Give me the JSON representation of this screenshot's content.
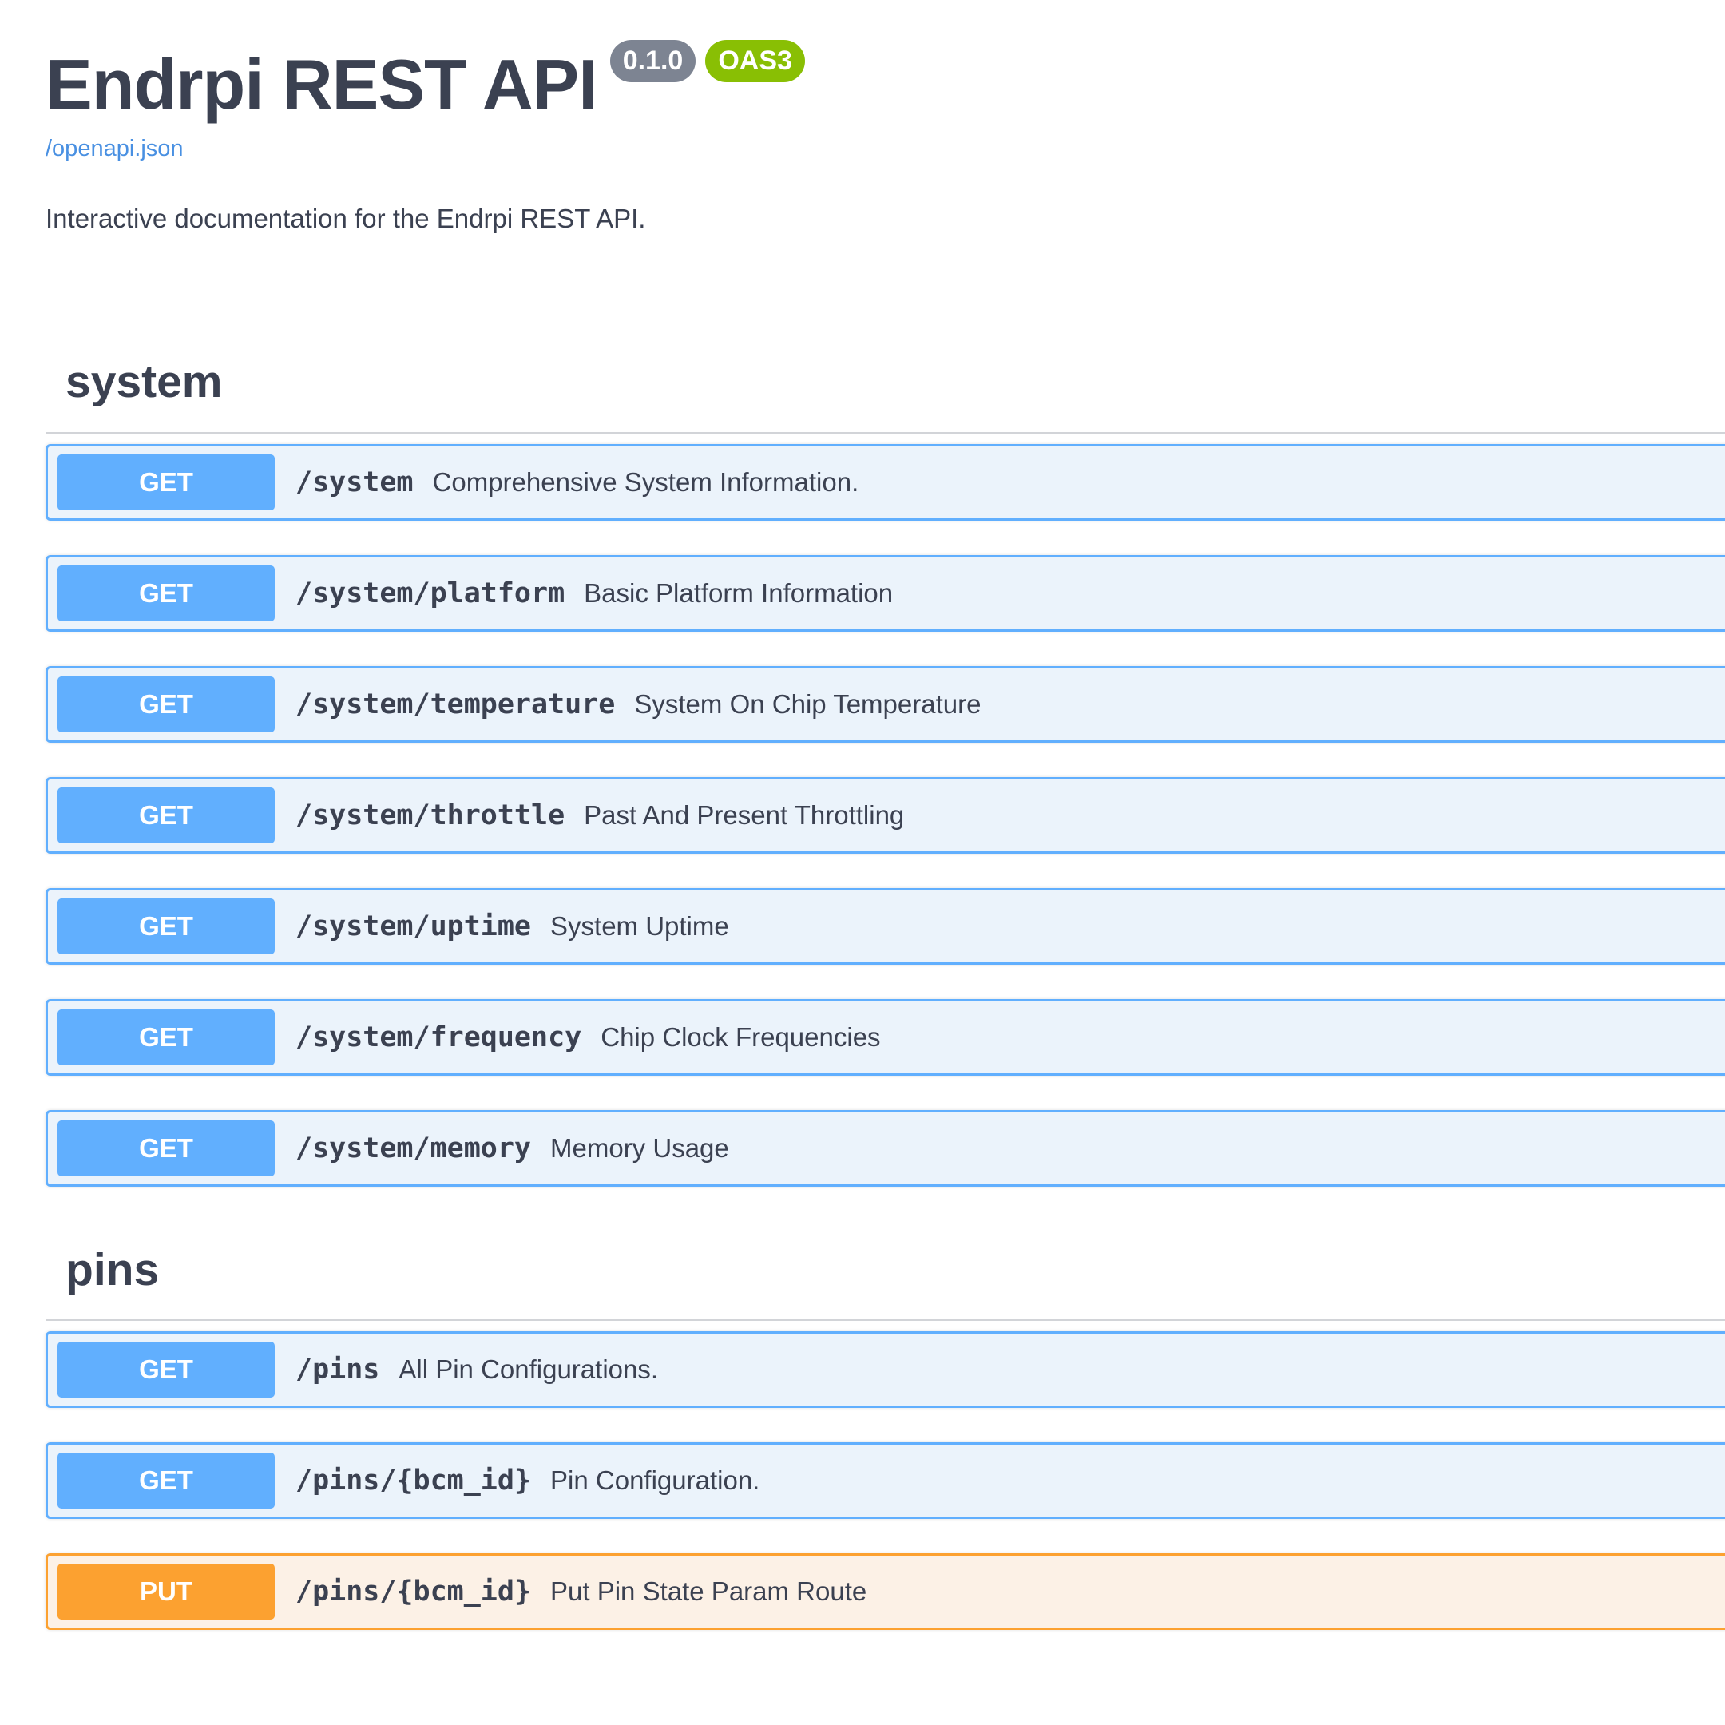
{
  "info": {
    "title": "Endrpi REST API",
    "version": "0.1.0",
    "oas_badge": "OAS3",
    "spec_link": "/openapi.json",
    "description": "Interactive documentation for the Endrpi REST API."
  },
  "sections": [
    {
      "name": "system",
      "operations": [
        {
          "method": "GET",
          "path": "/system",
          "summary": "Comprehensive System Information."
        },
        {
          "method": "GET",
          "path": "/system/platform",
          "summary": "Basic Platform Information"
        },
        {
          "method": "GET",
          "path": "/system/temperature",
          "summary": "System On Chip Temperature"
        },
        {
          "method": "GET",
          "path": "/system/throttle",
          "summary": "Past And Present Throttling"
        },
        {
          "method": "GET",
          "path": "/system/uptime",
          "summary": "System Uptime"
        },
        {
          "method": "GET",
          "path": "/system/frequency",
          "summary": "Chip Clock Frequencies"
        },
        {
          "method": "GET",
          "path": "/system/memory",
          "summary": "Memory Usage"
        }
      ]
    },
    {
      "name": "pins",
      "operations": [
        {
          "method": "GET",
          "path": "/pins",
          "summary": "All Pin Configurations."
        },
        {
          "method": "GET",
          "path": "/pins/{bcm_id}",
          "summary": "Pin Configuration."
        },
        {
          "method": "PUT",
          "path": "/pins/{bcm_id}",
          "summary": "Put Pin State Param Route"
        }
      ]
    }
  ],
  "colors": {
    "get": "#61affe",
    "get_bg": "#ebf3fb",
    "put": "#fca130",
    "put_bg": "#fcf1e6",
    "version_badge": "#7d8492",
    "oas_badge": "#89bf04",
    "link": "#4990e2",
    "text": "#3b4151"
  }
}
